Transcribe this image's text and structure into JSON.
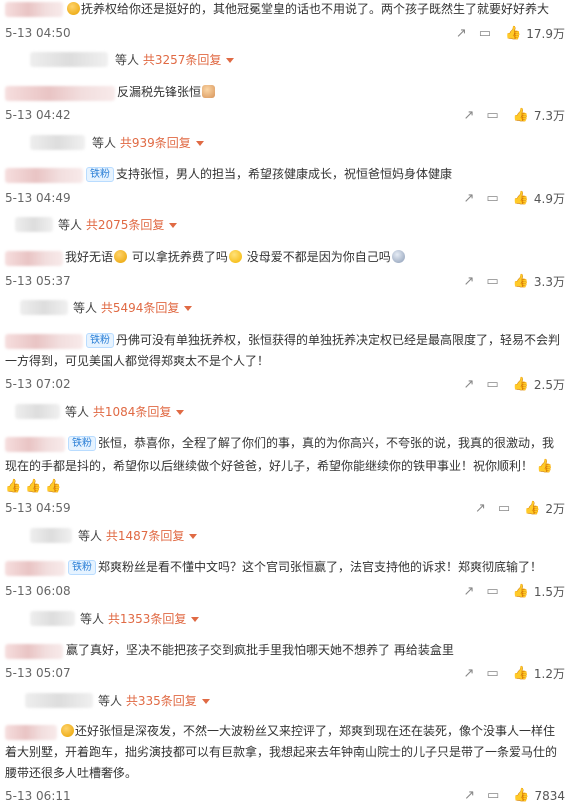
{
  "comments": [
    {
      "prefix_icon": "smiley-emoji",
      "lines": [
        "抚养权给你还是挺好的，其他冠冕堂皇的话也不用说了。两个孩子既然生了就要好好养大"
      ],
      "time": "5-13 04:50",
      "likes": "17.9万",
      "reply_prefix": "等人",
      "reply_count": "共3257条回复"
    },
    {
      "lines": [
        "反漏税先锋张恒"
      ],
      "suffix_icon": "cat-emoji",
      "time": "5-13 04:42",
      "likes": "7.3万",
      "reply_prefix": "等人",
      "reply_count": "共939条回复"
    },
    {
      "badge": "铁粉",
      "lines": [
        "支持张恒，男人的担当，希望孩健康成长，祝恒爸恒妈身体健康"
      ],
      "time": "5-13 04:49",
      "likes": "4.9万",
      "reply_prefix": "等人",
      "reply_count": "共2075条回复"
    },
    {
      "line_parts": [
        "我好无语",
        "可以拿抚养费了吗",
        "没母爱不都是因为你自己吗"
      ],
      "time": "5-13 05:37",
      "likes": "3.3万",
      "reply_prefix": "等人",
      "reply_count": "共5494条回复"
    },
    {
      "badge": "铁粉",
      "lines": [
        "丹佛可没有单独抚养权，张恒获得的单独抚养决定权已经是最高限度了，轻易不会判",
        "一方得到，可见美国人都觉得郑爽太不是个人了！"
      ],
      "time": "5-13 07:02",
      "likes": "2.5万",
      "reply_prefix": "等人",
      "reply_count": "共1084条回复"
    },
    {
      "badge": "铁粉",
      "lines": [
        "张恒，恭喜你，全程了解了你们的事，真的为你高兴，不夸张的说，我真的很激动，我",
        "现在的手都是抖的，希望你以后继续做个好爸爸，好儿子，希望你能继续你的铁甲事业！祝你顺利！"
      ],
      "time": "5-13 04:59",
      "likes": "2万",
      "reply_prefix": "等人",
      "reply_count": "共1487条回复"
    },
    {
      "badge": "铁粉",
      "lines": [
        "郑爽粉丝是看不懂中文吗？这个官司张恒赢了，法官支持他的诉求！郑爽彻底输了！"
      ],
      "time": "5-13 06:08",
      "likes": "1.5万",
      "reply_prefix": "等人",
      "reply_count": "共1353条回复"
    },
    {
      "lines": [
        "赢了真好，坚决不能把孩子交到疯批手里我怕哪天她不想养了 再给装盒里"
      ],
      "time": "5-13 05:07",
      "likes": "1.2万",
      "reply_prefix": "等人",
      "reply_count": "共335条回复"
    },
    {
      "prefix_icon": "smiley-emoji",
      "lines": [
        "还好张恒是深夜发，不然一大波粉丝又来控评了，郑爽到现在还在装死，像个没事人一样住",
        "着大别墅，开着跑车，拙劣演技都可以有巨款拿，我想起来去年钟南山院士的儿子只是带了一条爱马仕的",
        "腰带还很多人吐槽奢侈。"
      ],
      "time": "5-13 06:11",
      "likes": "7834"
    }
  ]
}
